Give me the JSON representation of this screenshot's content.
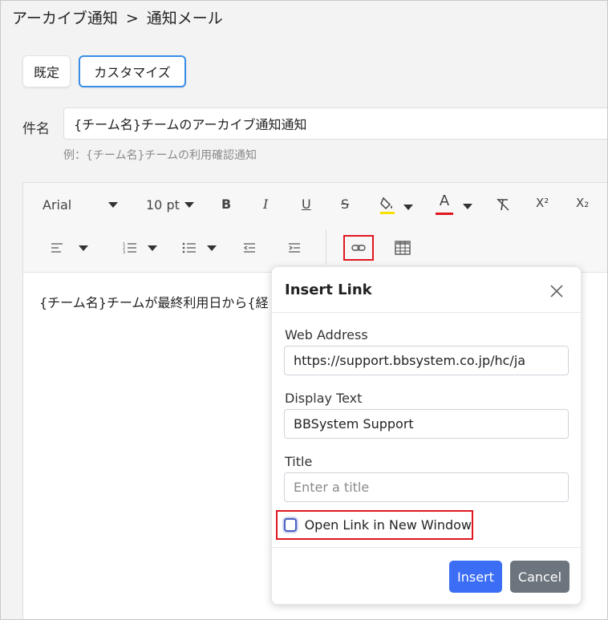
{
  "breadcrumb": {
    "parent": "アーカイブ通知",
    "separator": ">",
    "current": "通知メール"
  },
  "mode_tabs": {
    "default_label": "既定",
    "custom_label": "カスタマイズ"
  },
  "subject": {
    "label": "件名",
    "value": "{チーム名}チームのアーカイブ通知通知",
    "hint": "例：{チーム名}チームの利用確認通知"
  },
  "toolbar": {
    "font_family": "Arial",
    "font_size": "10 pt",
    "bold": "B",
    "italic": "I",
    "underline": "U",
    "strikethrough": "S",
    "font_color": "A",
    "superscript": "X²",
    "subscript": "X₂",
    "highlight_color": "#f5e000",
    "font_color_value": "#e0161e"
  },
  "editor": {
    "body_text": "{チーム名}チームが最終利用日から{経"
  },
  "dialog": {
    "title": "Insert Link",
    "web_address_label": "Web Address",
    "web_address_value": "https://support.bbsystem.co.jp/hc/ja",
    "display_text_label": "Display Text",
    "display_text_value": "BBSystem Support",
    "title_label": "Title",
    "title_placeholder": "Enter a title",
    "new_window_label": "Open Link in New Window",
    "insert_label": "Insert",
    "cancel_label": "Cancel"
  },
  "colors": {
    "accent_blue": "#3b6ef5",
    "highlight_red": "#e0161e",
    "cancel_gray": "#6c757d"
  }
}
